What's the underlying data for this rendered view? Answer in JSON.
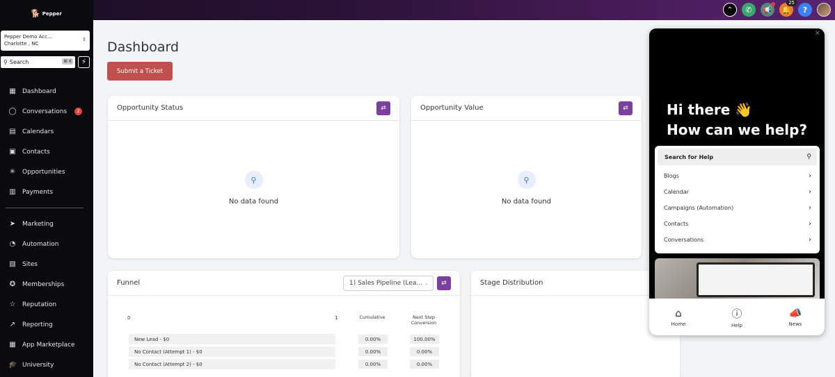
{
  "brand": {
    "logo_text": "Pepper"
  },
  "account": {
    "name": "Pepper Demo Acc...",
    "location": "Charlotte , NC"
  },
  "search": {
    "placeholder": "Search",
    "shortcut": "⌘ K"
  },
  "topbar": {
    "notifications_count": "25",
    "help_label": "?"
  },
  "nav": {
    "primary": [
      {
        "label": "Dashboard",
        "icon": "grid-icon"
      },
      {
        "label": "Conversations",
        "icon": "chat-icon",
        "badge": "2"
      },
      {
        "label": "Calendars",
        "icon": "calendar-icon"
      },
      {
        "label": "Contacts",
        "icon": "contacts-icon"
      },
      {
        "label": "Opportunities",
        "icon": "opportunities-icon"
      },
      {
        "label": "Payments",
        "icon": "payments-icon"
      }
    ],
    "secondary": [
      {
        "label": "Marketing",
        "icon": "send-icon"
      },
      {
        "label": "Automation",
        "icon": "automation-icon"
      },
      {
        "label": "Sites",
        "icon": "sites-icon"
      },
      {
        "label": "Memberships",
        "icon": "award-icon"
      },
      {
        "label": "Reputation",
        "icon": "star-icon"
      },
      {
        "label": "Reporting",
        "icon": "trend-icon"
      },
      {
        "label": "App Marketplace",
        "icon": "apps-icon"
      },
      {
        "label": "University",
        "icon": "graduation-icon"
      }
    ]
  },
  "main": {
    "title": "Dashboard",
    "ticket_button": "Submit a Ticket",
    "opportunity_status": {
      "title": "Opportunity Status",
      "empty": "No data found"
    },
    "opportunity_value": {
      "title": "Opportunity Value",
      "empty": "No data found"
    },
    "funnel": {
      "title": "Funnel",
      "pipeline": "1) Sales Pipeline (Lea...",
      "axis_start": "0",
      "axis_end": "1",
      "col_cumulative": "Cumulative",
      "col_next_step": "Next Step Conversion",
      "rows": [
        {
          "stage": "New Lead - $0",
          "cumulative": "0.00%",
          "next": "100.00%"
        },
        {
          "stage": "No Contact (Attempt 1) - $0",
          "cumulative": "0.00%",
          "next": "0.00%"
        },
        {
          "stage": "No Contact (Attempt 2) - $0",
          "cumulative": "0.00%",
          "next": "0.00%"
        }
      ]
    },
    "stage_distribution": {
      "title": "Stage Distribution"
    }
  },
  "help_widget": {
    "greeting_line1": "Hi there 👋",
    "greeting_line2": "How can we help?",
    "search_label": "Search for Help",
    "links": [
      "Blogs",
      "Calendar",
      "Campaigns (Automation)",
      "Contacts",
      "Conversations"
    ],
    "tabs": [
      {
        "label": "Home",
        "icon": "home-icon"
      },
      {
        "label": "Help",
        "icon": "help-circle-icon"
      },
      {
        "label": "News",
        "icon": "megaphone-icon"
      }
    ]
  }
}
